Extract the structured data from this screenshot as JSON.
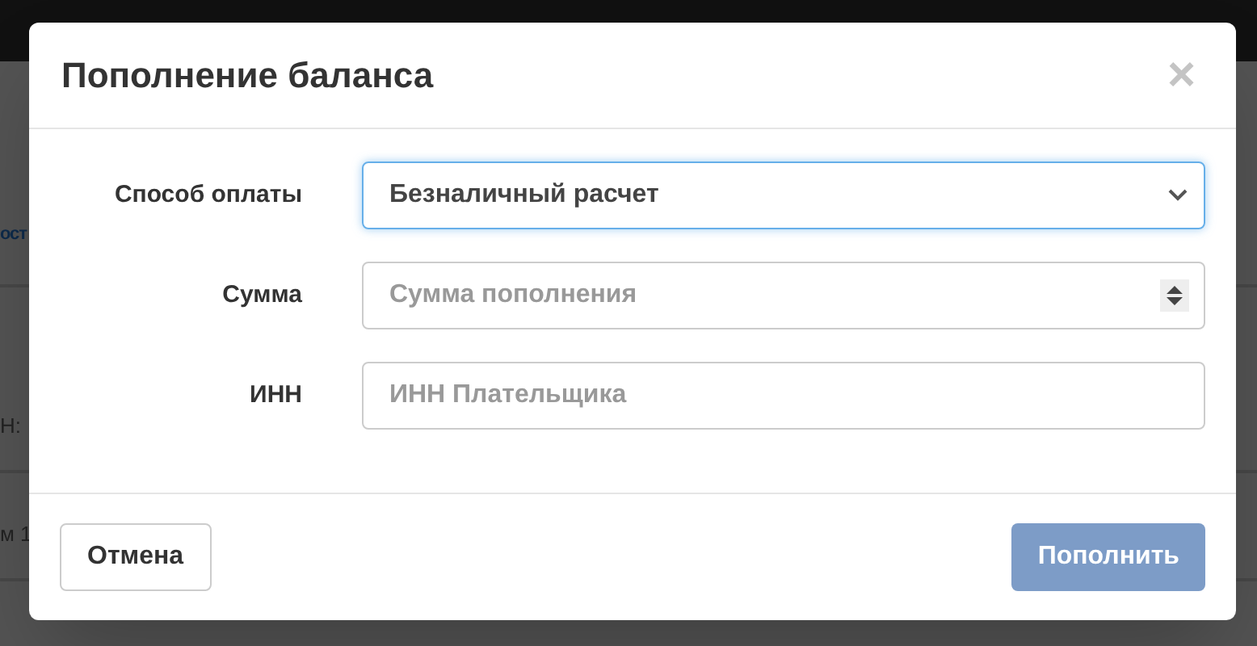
{
  "background": {
    "fragments": [
      {
        "text": "ост",
        "kind": "link"
      },
      {
        "text": "Н:",
        "kind": "plain"
      },
      {
        "text": "м 1",
        "kind": "plain"
      }
    ]
  },
  "modal": {
    "title": "Пополнение баланса",
    "close": "×",
    "fields": [
      {
        "label": "Способ оплаты",
        "kind": "select",
        "value": "Безналичный расчет",
        "focused": true
      },
      {
        "label": "Сумма",
        "kind": "number",
        "placeholder": "Сумма пополнения",
        "focused": false
      },
      {
        "label": "ИНН",
        "kind": "text",
        "placeholder": "ИНН Плательщика",
        "focused": false
      }
    ],
    "buttons": [
      {
        "label": "Отмена",
        "kind": "secondary",
        "disabled": false
      },
      {
        "label": "Пополнить",
        "kind": "primary",
        "disabled": true
      }
    ]
  }
}
